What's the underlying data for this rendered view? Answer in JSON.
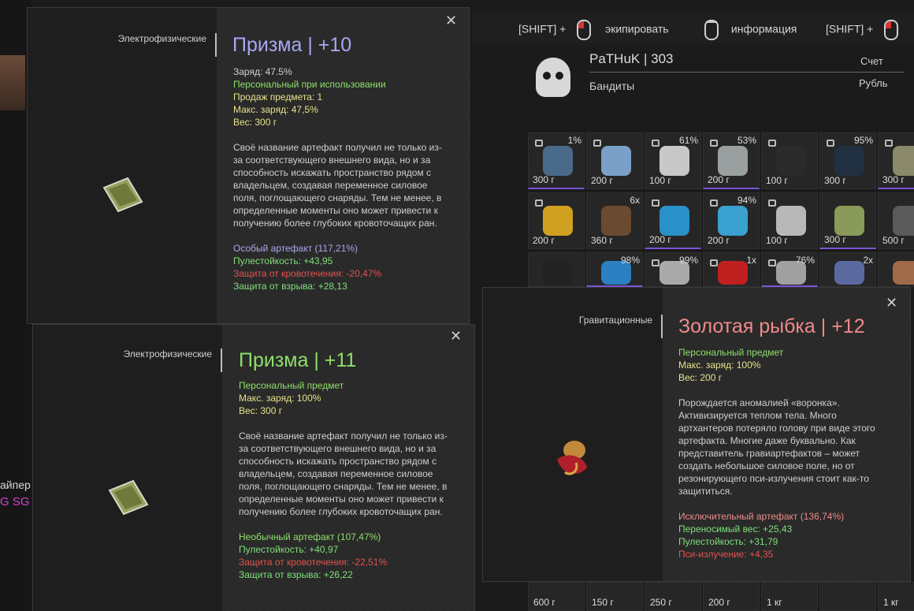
{
  "hints": [
    {
      "prefix": "[SHIFT] +",
      "label": "экипировать"
    },
    {
      "prefix": "",
      "label": "информация"
    },
    {
      "prefix": "[SHIFT] +",
      "label": ""
    }
  ],
  "background": {
    "left_text": "айпер",
    "left_text2": "G SG S"
  },
  "player": {
    "name": "PaTHuK  |  303",
    "faction": "Бандиты",
    "account_label": "Счет",
    "currency_label": "Рубль"
  },
  "inventory": [
    {
      "pct": "1%",
      "weight": "300 г",
      "locked": true
    },
    {
      "pct": "",
      "weight": "200 г",
      "locked": true
    },
    {
      "pct": "61%",
      "weight": "100 г",
      "locked": true
    },
    {
      "pct": "53%",
      "weight": "200 г",
      "locked": true
    },
    {
      "pct": "",
      "weight": "100 г",
      "locked": true
    },
    {
      "pct": "95%",
      "weight": "300 г",
      "locked": true
    },
    {
      "pct": "",
      "weight": "300 г",
      "locked": true
    },
    {
      "pct": "",
      "weight": "200 г",
      "locked": true
    },
    {
      "pct": "6x",
      "weight": "360 г",
      "locked": false
    },
    {
      "pct": "",
      "weight": "200 г",
      "locked": true
    },
    {
      "pct": "94%",
      "weight": "200 г",
      "locked": true
    },
    {
      "pct": "",
      "weight": "100 г",
      "locked": true
    },
    {
      "pct": "",
      "weight": "300 г",
      "locked": false
    },
    {
      "pct": "",
      "weight": "500 г",
      "locked": false
    },
    {
      "pct": "",
      "weight": "",
      "locked": false
    },
    {
      "pct": "98%",
      "weight": "",
      "locked": false
    },
    {
      "pct": "99%",
      "weight": "",
      "locked": true
    },
    {
      "pct": "1x",
      "weight": "",
      "locked": true
    },
    {
      "pct": "76%",
      "weight": "",
      "locked": true
    },
    {
      "pct": "2x",
      "weight": "",
      "locked": false
    },
    {
      "pct": "",
      "weight": "",
      "locked": false
    }
  ],
  "bottom_row": [
    "600 г",
    "150 г",
    "250 г",
    "200 г",
    "1 кг",
    "",
    "1 кг"
  ],
  "tooltip1": {
    "category": "Электрофизические",
    "title": "Призма | +10",
    "stats": {
      "charge": "Заряд: 47.5%",
      "personal": "Персональный при использовании",
      "sales": "Продаж предмета: 1",
      "max_charge": "Макс. заряд: 47,5%",
      "weight": "Вес: 300 г"
    },
    "description": "Своё название артефакт получил не только из-за соответствующего внешнего вида, но и за способность искажать пространство рядом с владельцем, создавая переменное силовое поля, поглощающего снаряды. Тем не менее, в определенные моменты оно может привести к получению более глубоких кровоточащих ран.",
    "rarity": "Особый артефакт (117,21%)",
    "effects": [
      {
        "text": "Пулестойкость: +43,95",
        "kind": "green"
      },
      {
        "text": "Защита от кровотечения: -20,47%",
        "kind": "red"
      },
      {
        "text": "Защита от взрыва: +28,13",
        "kind": "green"
      }
    ]
  },
  "tooltip2": {
    "category": "Электрофизические",
    "title": "Призма | +11",
    "stats": {
      "personal": "Персональный предмет",
      "max_charge": "Макс. заряд: 100%",
      "weight": "Вес: 300 г"
    },
    "description": "Своё название артефакт получил не только из-за соответствующего внешнего вида, но и за способность искажать пространство рядом с владельцем, создавая переменное силовое поля, поглощающего снаряды. Тем не менее, в определенные моменты оно может привести к получению более глубоких кровоточащих ран.",
    "rarity": "Необычный артефакт (107,47%)",
    "effects": [
      {
        "text": "Пулестойкость: +40,97",
        "kind": "green"
      },
      {
        "text": "Защита от кровотечения: -22,51%",
        "kind": "red"
      },
      {
        "text": "Защита от взрыва: +26,22",
        "kind": "green"
      }
    ]
  },
  "tooltip3": {
    "category": "Гравитационные",
    "title": "Золотая рыбка | +12",
    "stats": {
      "personal": "Персональный предмет",
      "max_charge": "Макс. заряд: 100%",
      "weight": "Вес: 200 г"
    },
    "description": "Порождается аномалией «воронка». Активизируется теплом тела. Много артхантеров потеряло голову при виде этого артефакта. Многие даже буквально. Как представитель гравиартефактов – может создать небольшое силовое поле, но от резонирующего пси-излучения стоит как-то защититься.",
    "rarity": "Исключительный артефакт (136,74%)",
    "effects": [
      {
        "text": "Переносимый вес: +25,43",
        "kind": "green"
      },
      {
        "text": "Пулестойкость: +31,79",
        "kind": "green"
      },
      {
        "text": "Пси-излучение: +4,35",
        "kind": "red"
      }
    ]
  },
  "colors": {
    "title_purple": "#a8a8f0",
    "title_green": "#8fe06a",
    "title_red": "#f08a8a",
    "stat_yellow": "#e6e28a",
    "effect_green": "#7ee07a",
    "effect_red": "#e0534f"
  },
  "icons": {
    "close": "close-icon",
    "mouse_left": "mouse-left-icon",
    "mouse_right": "mouse-right-icon",
    "faction": "skull-icon",
    "lock": "lock-icon"
  }
}
